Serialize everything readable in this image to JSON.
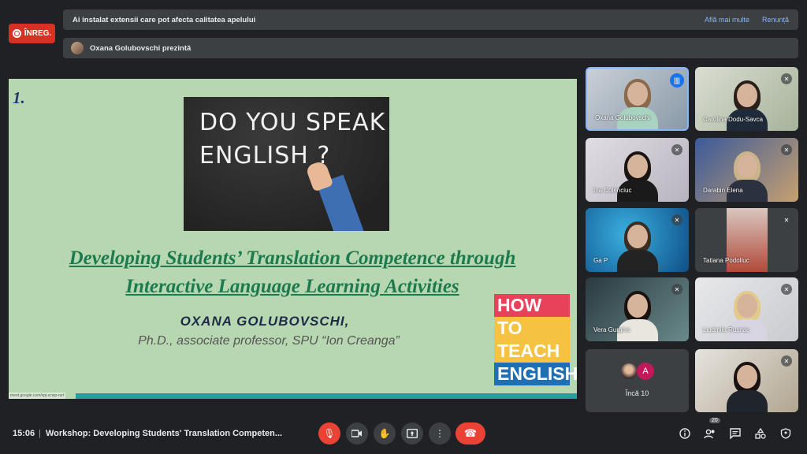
{
  "recording": {
    "label": "ÎNREG."
  },
  "warning": {
    "text": "Ai instalat extensii care pot afecta calitatea apelului",
    "learn_more": "Află mai multe",
    "dismiss": "Renunță"
  },
  "presenting": {
    "text": "Oxana Golubovschi prezintă"
  },
  "slide": {
    "number": "1.",
    "board_text": "DO YOU SPEAK\nENGLISH ?",
    "title_line1": "Developing Students’ Translation Competence through",
    "title_line2": "Interactive Language Learning Activities",
    "author": "OXANA GOLUBOVSCHI,",
    "subtitle": "Ph.D., associate professor, SPU “Ion Creanga”",
    "logo": [
      "HOW",
      "TO TEACH",
      "ENGLISH"
    ],
    "url": "meet.google.com/vpj-xcwp-rurt"
  },
  "participants": [
    {
      "name": "Oxana Golubovschi",
      "state": "speaking"
    },
    {
      "name": "Carolina Dodu-Savca",
      "state": "muted"
    },
    {
      "name": "Ina Colenciuc",
      "state": "muted"
    },
    {
      "name": "Darabin Elena",
      "state": "muted"
    },
    {
      "name": "Ga P",
      "state": "muted"
    },
    {
      "name": "Tatiana Podoliuc",
      "state": "muted"
    },
    {
      "name": "Vera Gurghis",
      "state": "muted"
    },
    {
      "name": "Liudmila Rusnac",
      "state": "muted"
    }
  ],
  "more": {
    "avatar_letter": "A",
    "label": "Încă 10"
  },
  "bottom": {
    "time": "15:06",
    "separator": "|",
    "meeting_title": "Workshop: Developing Students' Translation Competen...",
    "participant_count": "20"
  },
  "colors": {
    "accent": "#8ab4f8",
    "danger": "#ea4335",
    "speaking": "#1a73e8",
    "bar": "#3c4043"
  }
}
